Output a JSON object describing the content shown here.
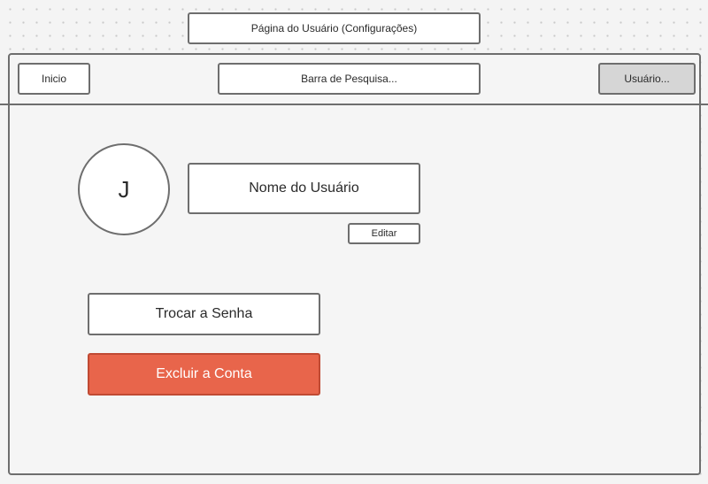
{
  "page_title": "Página do Usuário (Configurações)",
  "header": {
    "home_label": "Inicio",
    "search_label": "Barra de Pesquisa...",
    "user_menu_label": "Usuário..."
  },
  "profile": {
    "avatar_initial": "J",
    "username": "Nome do Usuário",
    "edit_label": "Editar"
  },
  "actions": {
    "change_password_label": "Trocar a Senha",
    "delete_account_label": "Excluir a Conta"
  },
  "colors": {
    "danger": "#e8654b"
  }
}
